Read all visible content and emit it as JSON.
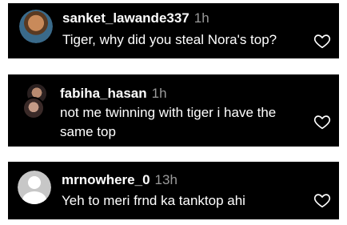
{
  "comments": [
    {
      "username": "sanket_lawande337",
      "time": "1h",
      "text": "Tiger, why did you steal Nora's top?",
      "avatar": "profile-photo",
      "like_icon": "heart-outline-icon"
    },
    {
      "username": "fabiha_hasan",
      "time": "1h",
      "text": "not me twinning with tiger i have the same top",
      "avatar": "stacked-profile-photos",
      "like_icon": "heart-outline-icon"
    },
    {
      "username": "mrnowhere_0",
      "time": "13h",
      "text": "Yeh to meri frnd ka tanktop ahi",
      "avatar": "default-avatar",
      "like_icon": "heart-outline-icon"
    }
  ]
}
